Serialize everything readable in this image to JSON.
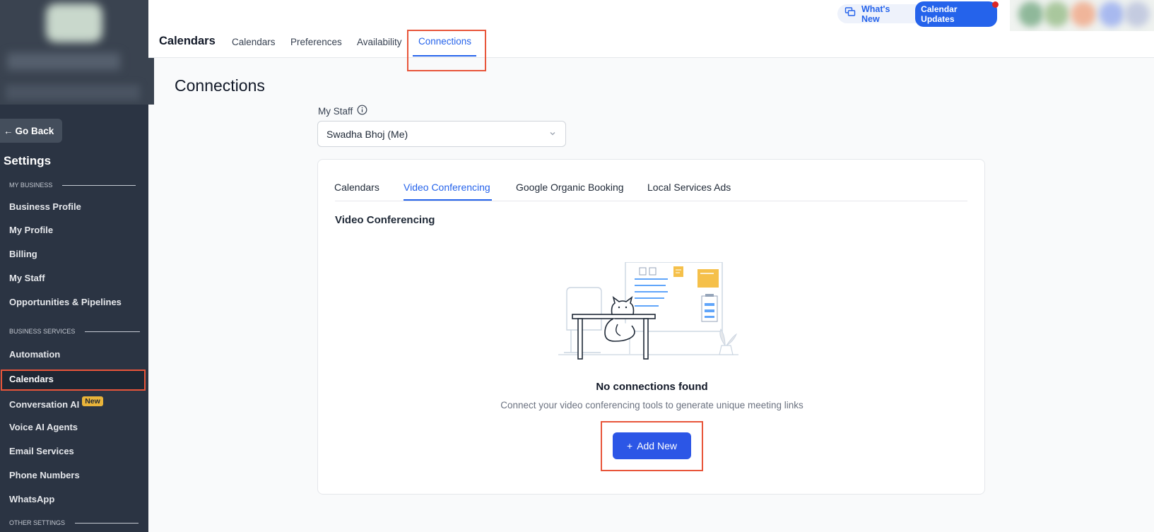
{
  "sidebar": {
    "go_back": "Go Back",
    "title": "Settings",
    "sections": {
      "my_business": "MY BUSINESS",
      "business_services": "BUSINESS SERVICES",
      "other_settings": "OTHER SETTINGS"
    },
    "items": [
      {
        "label": "Business Profile"
      },
      {
        "label": "My Profile"
      },
      {
        "label": "Billing"
      },
      {
        "label": "My Staff"
      },
      {
        "label": "Opportunities & Pipelines"
      },
      {
        "label": "Automation"
      },
      {
        "label": "Calendars"
      },
      {
        "label": "Conversation AI",
        "badge": "New"
      },
      {
        "label": "Voice AI Agents"
      },
      {
        "label": "Email Services"
      },
      {
        "label": "Phone Numbers"
      },
      {
        "label": "WhatsApp"
      }
    ]
  },
  "header": {
    "title": "Calendars",
    "tabs": [
      {
        "label": "Calendars"
      },
      {
        "label": "Preferences"
      },
      {
        "label": "Availability"
      },
      {
        "label": "Connections"
      }
    ],
    "whats_new": "What's New",
    "calendar_updates": "Calendar Updates"
  },
  "main": {
    "title": "Connections",
    "staff_label": "My Staff",
    "staff_value": "Swadha Bhoj (Me)",
    "card": {
      "tabs": [
        {
          "label": "Calendars"
        },
        {
          "label": "Video Conferencing"
        },
        {
          "label": "Google Organic Booking"
        },
        {
          "label": "Local Services Ads"
        }
      ],
      "section_title": "Video Conferencing",
      "empty_title": "No connections found",
      "empty_subtitle": "Connect your video conferencing tools to generate unique meeting links",
      "add_button": "Add New"
    }
  },
  "colors": {
    "accent": "#2563eb",
    "sidebar_bg": "#2b3443",
    "highlight": "#e8553a",
    "badge": "#e9b43a"
  }
}
